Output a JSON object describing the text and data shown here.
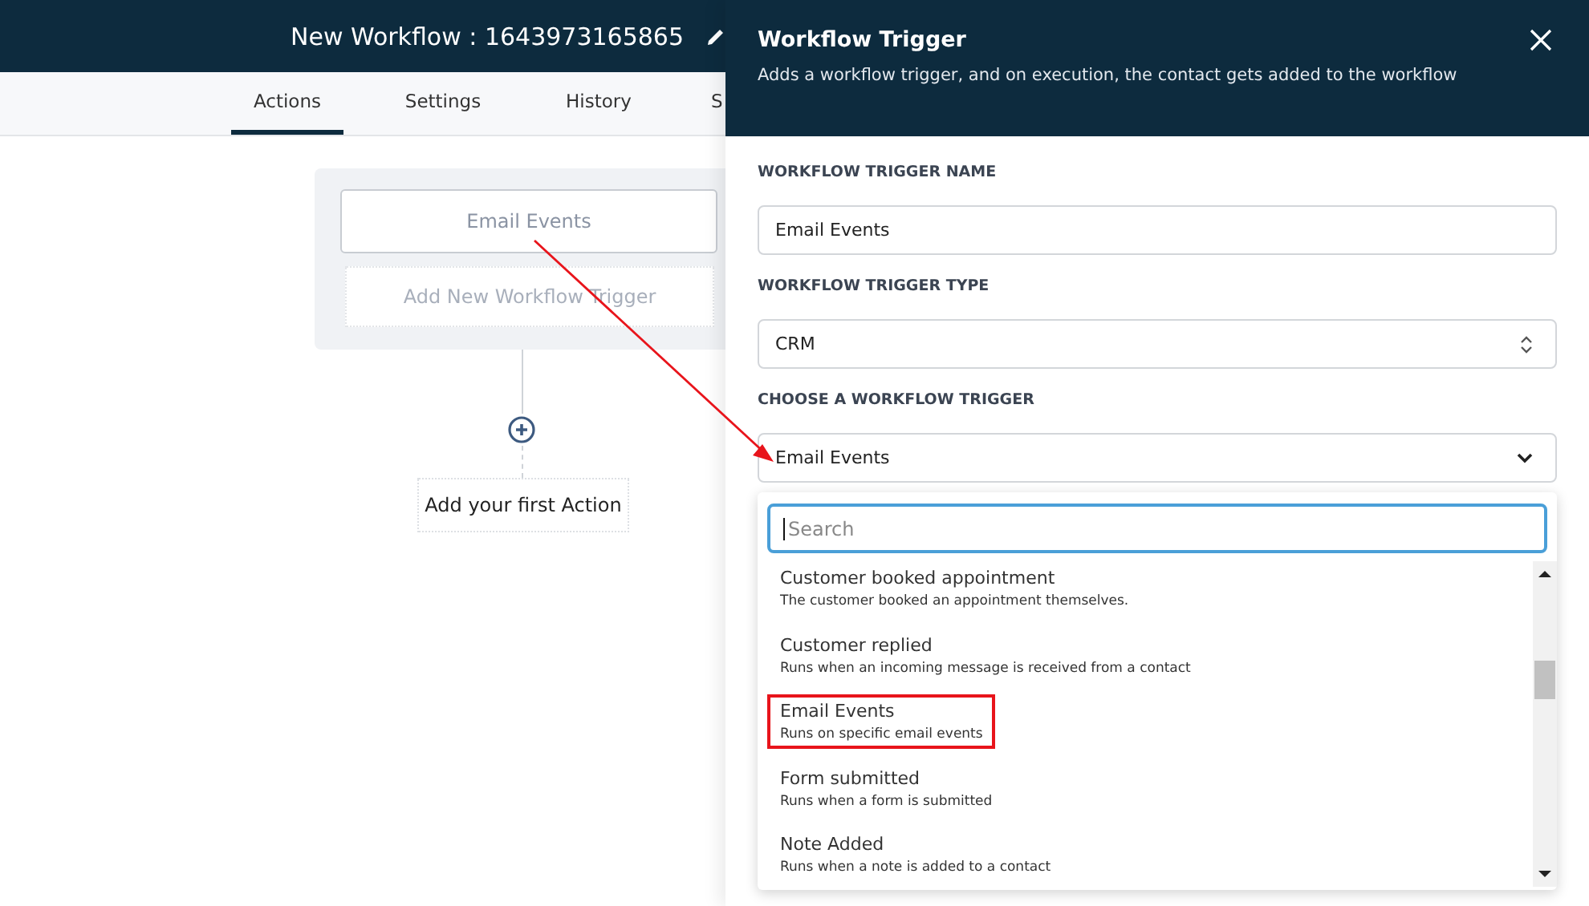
{
  "header": {
    "title": "New Workflow : 1643973165865"
  },
  "tabs": [
    {
      "label": "Actions",
      "selected": true
    },
    {
      "label": "Settings",
      "selected": false
    },
    {
      "label": "History",
      "selected": false
    },
    {
      "label": "S",
      "selected": false
    }
  ],
  "canvas": {
    "trigger_node": "Email Events",
    "add_trigger": "Add New Workflow Trigger",
    "add_action": "Add your first Action"
  },
  "panel": {
    "title": "Workflow Trigger",
    "subtitle": "Adds a workflow trigger, and on execution, the contact gets added to the workflow",
    "fields": [
      {
        "kind": "text",
        "label": "WORKFLOW TRIGGER NAME",
        "value": "Email Events"
      },
      {
        "kind": "select",
        "label": "WORKFLOW TRIGGER TYPE",
        "value": "CRM"
      },
      {
        "kind": "dropdown",
        "label": "CHOOSE A WORKFLOW TRIGGER",
        "value": "Email Events"
      }
    ],
    "search": {
      "placeholder": "Search"
    },
    "options": [
      {
        "title": "Customer booked appointment",
        "description": "The customer booked an appointment themselves.",
        "highlighted": false
      },
      {
        "title": "Customer replied",
        "description": "Runs when an incoming message is received from a contact",
        "highlighted": false
      },
      {
        "title": "Email Events",
        "description": "Runs on specific email events",
        "highlighted": true
      },
      {
        "title": "Form submitted",
        "description": "Runs when a form is submitted",
        "highlighted": false
      },
      {
        "title": "Note Added",
        "description": "Runs when a note is added to a contact",
        "highlighted": false
      }
    ]
  }
}
